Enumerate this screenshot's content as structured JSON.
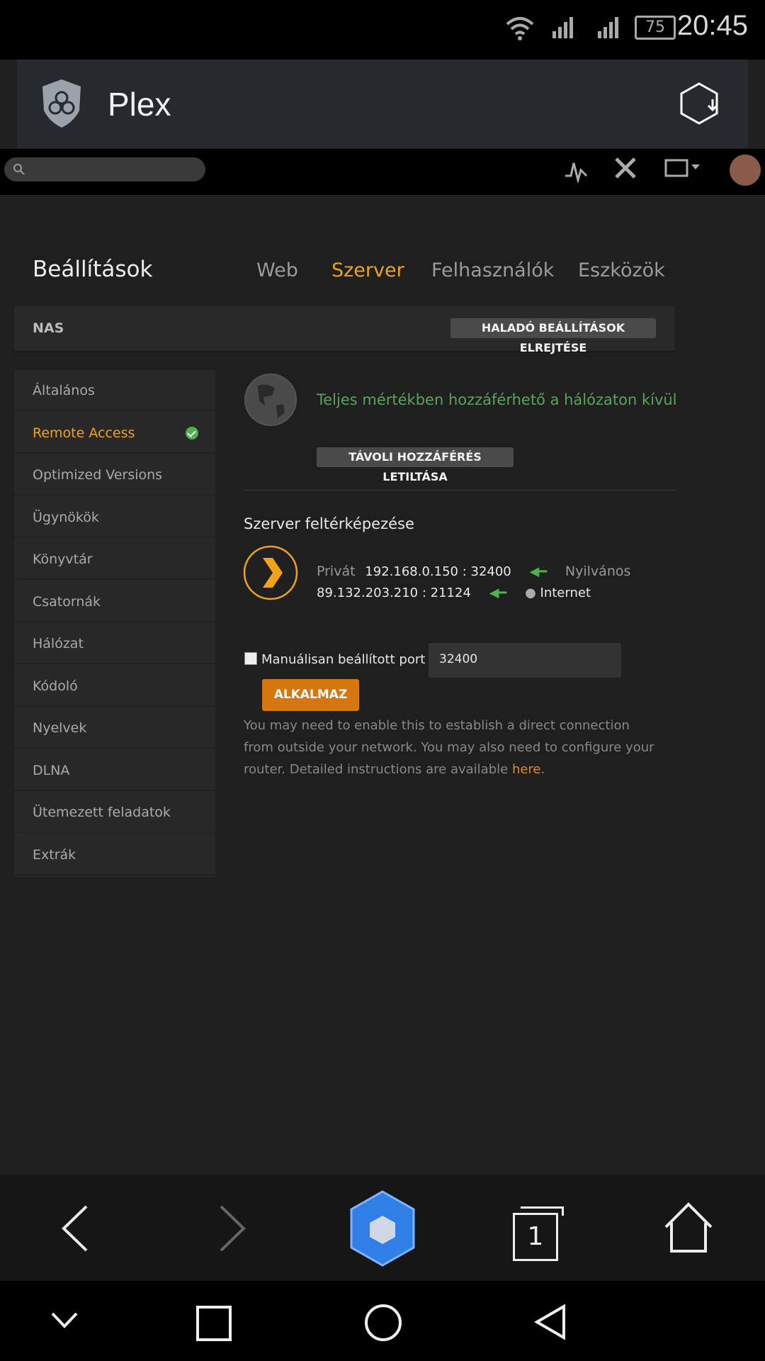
{
  "status_bar": {
    "time": "20:45",
    "battery": "75"
  },
  "app_bar": {
    "title": "Plex"
  },
  "settings": {
    "title": "Beállítások",
    "tabs": [
      "Web",
      "Szerver",
      "Felhasználók",
      "Eszközök"
    ],
    "active_tab": "Szerver",
    "server_name": "NAS",
    "advanced_button": "HALADÓ BEÁLLÍTÁSOK ELREJTÉSE"
  },
  "sidebar": {
    "items": [
      {
        "label": "Általános"
      },
      {
        "label": "Remote Access"
      },
      {
        "label": "Optimized Versions"
      },
      {
        "label": "Ügynökök"
      },
      {
        "label": "Könyvtár"
      },
      {
        "label": "Csatornák"
      },
      {
        "label": "Hálózat"
      },
      {
        "label": "Kódoló"
      },
      {
        "label": "Nyelvek"
      },
      {
        "label": "DLNA"
      },
      {
        "label": "Ütemezett feladatok"
      },
      {
        "label": "Extrák"
      }
    ],
    "active": "Remote Access"
  },
  "remote_access": {
    "status_text": "Teljes mértékben hozzáférhető a hálózaton kívül",
    "disable_button": "TÁVOLI HOZZÁFÉRÉS LETILTÁSA",
    "mapping_title": "Szerver feltérképezése",
    "private_label": "Privát",
    "private_address": "192.168.0.150 : 32400",
    "public_label": "Nyilvános",
    "public_address": "89.132.203.210 : 21124",
    "internet_label": "Internet",
    "manual_port_label": "Manuálisan beállított port",
    "manual_port_value": "32400",
    "apply_button": "ALKALMAZ",
    "help_text": "You may need to enable this to establish a direct connection from outside your network. You may also need to configure your router. Detailed instructions are available ",
    "help_link": "here",
    "help_end": "."
  },
  "browser_nav": {
    "tab_count": "1"
  },
  "colors": {
    "accent": "#f0a31a",
    "success": "#4fb04f",
    "background": "#1f1f1f"
  }
}
